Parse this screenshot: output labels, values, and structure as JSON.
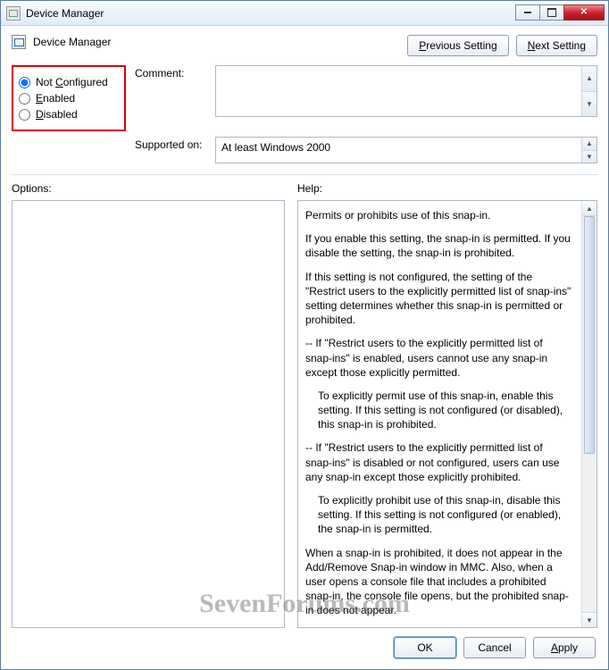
{
  "titlebar": {
    "title": "Device Manager"
  },
  "header": {
    "title": "Device Manager"
  },
  "nav": {
    "previous": "Previous Setting",
    "next": "Next Setting"
  },
  "state": {
    "options": [
      {
        "label": "Not Configured",
        "accel": "C",
        "selected": true
      },
      {
        "label": "Enabled",
        "accel": "E",
        "selected": false
      },
      {
        "label": "Disabled",
        "accel": "D",
        "selected": false
      }
    ]
  },
  "fields": {
    "comment_label": "Comment:",
    "comment_value": "",
    "supported_label": "Supported on:",
    "supported_value": "At least Windows 2000"
  },
  "panes": {
    "options_label": "Options:",
    "help_label": "Help:"
  },
  "help": {
    "p1": "Permits or prohibits use of this snap-in.",
    "p2": "If you enable this setting, the snap-in is permitted. If you disable the setting, the snap-in is prohibited.",
    "p3": "If this setting is not configured, the setting of the \"Restrict users to the explicitly permitted list of snap-ins\" setting determines whether this snap-in is permitted or prohibited.",
    "p4": "--  If \"Restrict users to the explicitly permitted list of snap-ins\" is enabled, users cannot use any snap-in except those explicitly permitted.",
    "p5": "To explicitly permit use of this snap-in, enable this setting. If this setting is not configured (or disabled), this snap-in is prohibited.",
    "p6": "--  If \"Restrict users to the explicitly permitted list of snap-ins\" is disabled or not configured, users can use any snap-in except those explicitly prohibited.",
    "p7": "To explicitly prohibit use of this snap-in, disable this setting. If this setting is not configured (or enabled), the snap-in is permitted.",
    "p8": "When a snap-in is prohibited, it does not appear in the Add/Remove Snap-in window in MMC. Also, when a user opens a console file that includes a prohibited snap-in, the console file opens, but the prohibited snap-in does not appear."
  },
  "footer": {
    "ok": "OK",
    "cancel": "Cancel",
    "apply": "Apply"
  },
  "watermark": "SevenForums.com"
}
